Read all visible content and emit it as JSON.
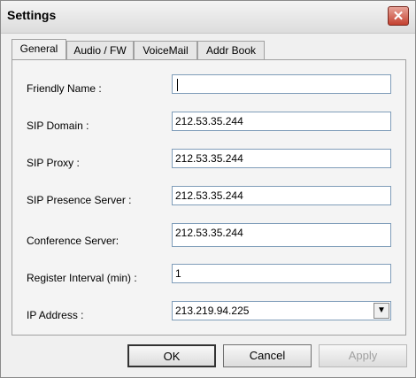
{
  "window": {
    "title": "Settings"
  },
  "tabs": [
    {
      "label": "General",
      "active": true
    },
    {
      "label": "Audio / FW",
      "active": false
    },
    {
      "label": "VoiceMail",
      "active": false
    },
    {
      "label": "Addr Book",
      "active": false
    }
  ],
  "form": {
    "friendly_name": {
      "label": "Friendly Name :",
      "value": ""
    },
    "sip_domain": {
      "label": "SIP Domain :",
      "value": "212.53.35.244"
    },
    "sip_proxy": {
      "label": "SIP Proxy :",
      "value": "212.53.35.244"
    },
    "sip_presence_server": {
      "label": "SIP Presence Server :",
      "value": "212.53.35.244"
    },
    "conference_server": {
      "label": "Conference Server:",
      "value": "212.53.35.244"
    },
    "register_interval": {
      "label": "Register Interval (min) :",
      "value": "1"
    },
    "ip_address": {
      "label": "IP Address :",
      "value": "213.219.94.225"
    }
  },
  "buttons": {
    "ok": "OK",
    "cancel": "Cancel",
    "apply": "Apply"
  },
  "icons": {
    "close": "close-icon",
    "dropdown": "chevron-down-icon"
  }
}
